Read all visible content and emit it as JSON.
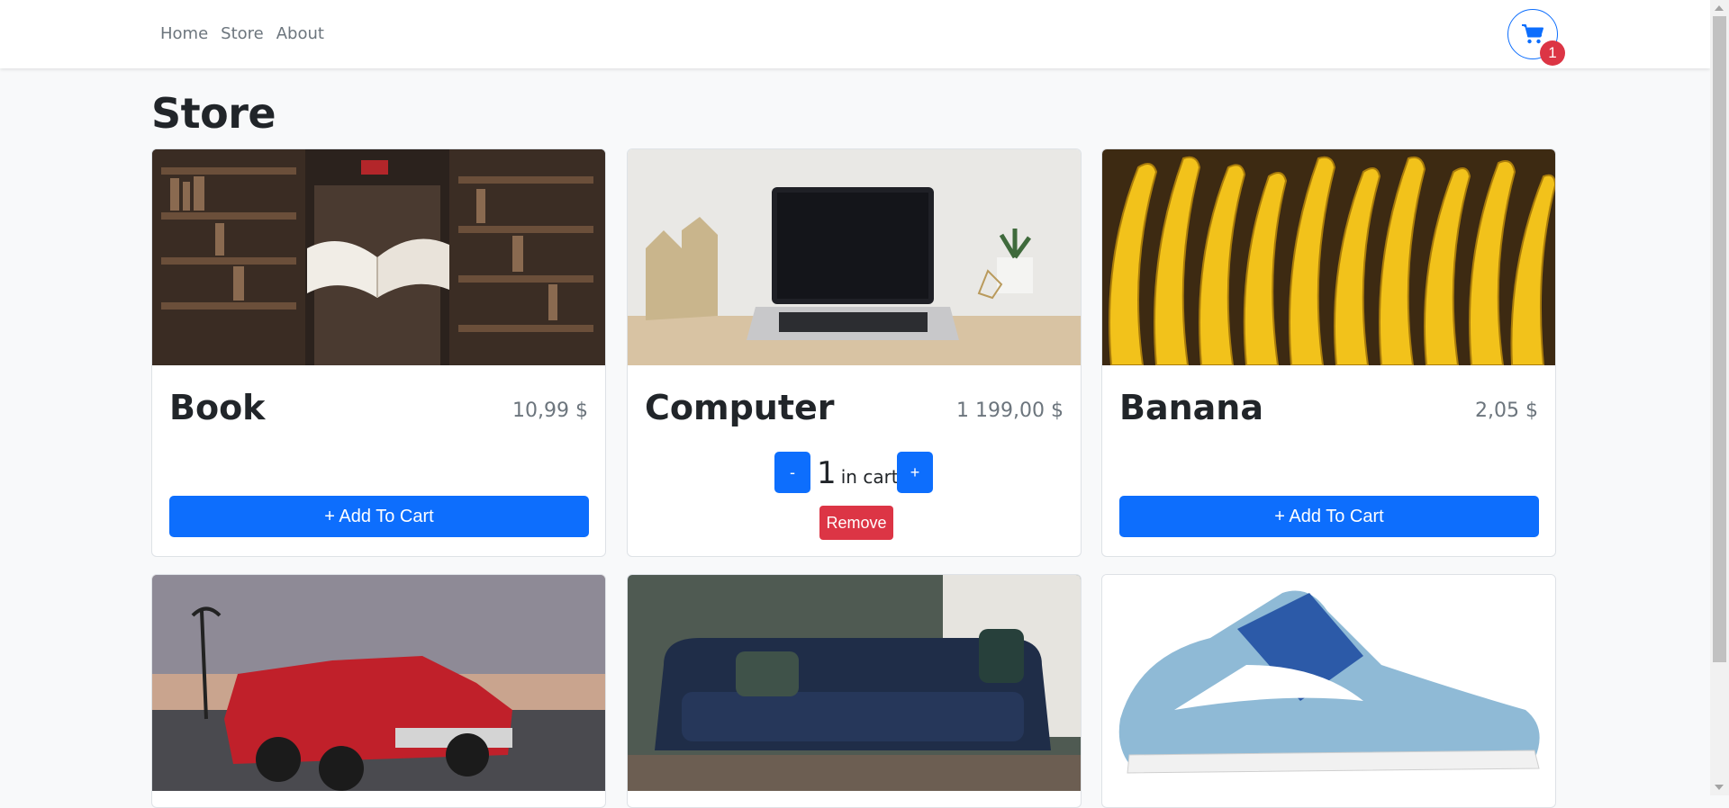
{
  "nav": {
    "links": [
      "Home",
      "Store",
      "About"
    ],
    "cart_count": "1"
  },
  "page": {
    "title": "Store"
  },
  "products": [
    {
      "name": "Book",
      "price": "10,99 $",
      "action": "+ Add To Cart"
    },
    {
      "name": "Computer",
      "price": "1 199,00 $",
      "quantity": "1",
      "in_cart_label": "in cart",
      "decrement": "-",
      "increment": "+",
      "remove": "Remove"
    },
    {
      "name": "Banana",
      "price": "2,05 $",
      "action": "+ Add To Cart"
    }
  ],
  "colors": {
    "primary": "#0d6efd",
    "danger": "#dc3545",
    "muted": "#6c757d",
    "background": "#f8f9fa"
  },
  "icons": [
    "cart-icon"
  ]
}
